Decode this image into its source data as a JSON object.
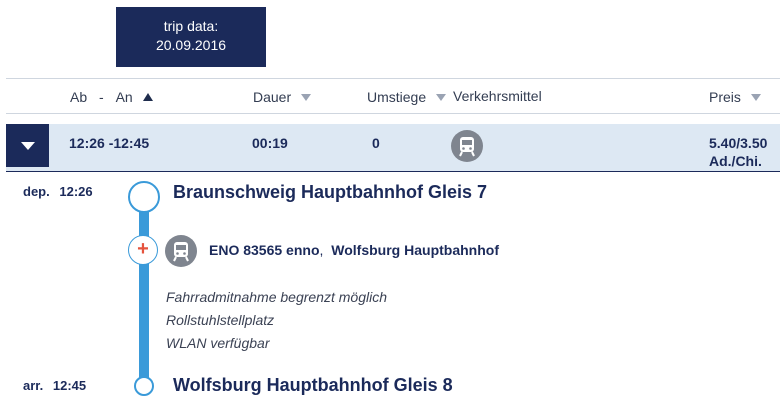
{
  "trip_box": {
    "line1": "trip data:",
    "line2": "20.09.2016"
  },
  "columns": {
    "ab": "Ab",
    "dash": "-",
    "an": "An",
    "dauer": "Dauer",
    "umstiege": "Umstiege",
    "verkehrsmittel": "Verkehrsmittel",
    "preis": "Preis"
  },
  "connection": {
    "time_range": "12:26 -12:45",
    "duration": "00:19",
    "changes": "0",
    "price": "5.40/3.50",
    "price_note": "Ad./Chi."
  },
  "departure": {
    "label": "dep.",
    "time": "12:26",
    "station": "Braunschweig Hauptbahnhof Gleis 7"
  },
  "train": {
    "number": "ENO 83565 enno",
    "direction": "Wolfsburg Hauptbahnhof"
  },
  "notes": [
    "Fahrradmitnahme begrenzt möglich",
    "Rollstuhlstellplatz",
    "WLAN verfügbar"
  ],
  "arrival": {
    "label": "arr.",
    "time": "12:45",
    "station": "Wolfsburg Hauptbahnhof Gleis 8"
  },
  "icons": {
    "train": "train-icon",
    "expand": "chevron-down-icon",
    "add": "plus-icon"
  },
  "colors": {
    "navy": "#1b2a5a",
    "row_bg": "#dde8f3",
    "timeline": "#3a9ad9",
    "plus": "#e5533d"
  }
}
